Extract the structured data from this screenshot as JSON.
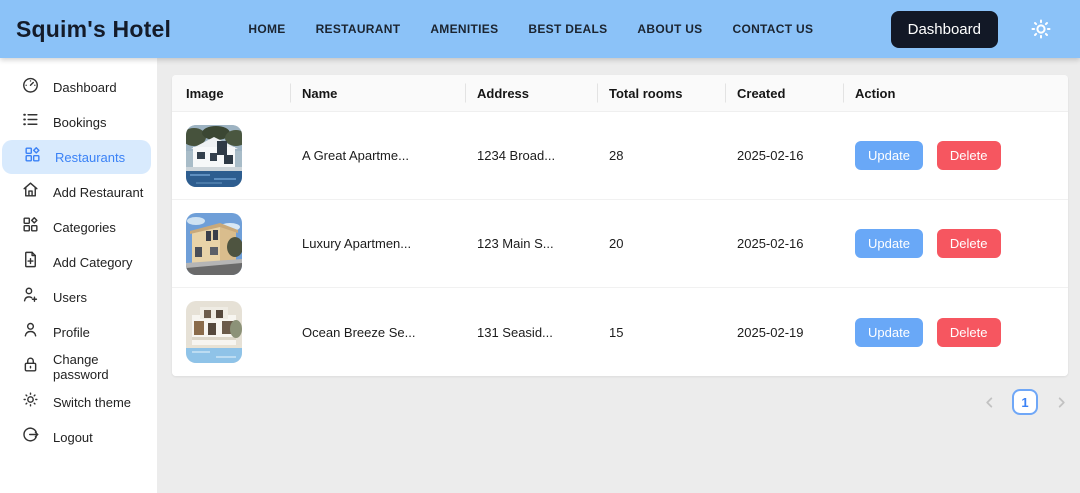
{
  "topbar": {
    "brand": "Squim's Hotel",
    "nav_items": [
      "HOME",
      "RESTAURANT",
      "AMENITIES",
      "BEST DEALS",
      "ABOUT US",
      "CONTACT US"
    ],
    "dashboard_button": "Dashboard",
    "theme_icon": "sun-icon",
    "colors": {
      "bg": "#8bc2f8",
      "button_bg": "#121826"
    }
  },
  "sidebar": {
    "active_item": "Restaurants",
    "colors": {
      "active_bg": "#d8eafd",
      "active_text": "#3b82f6"
    },
    "items": [
      {
        "label": "Dashboard",
        "icon": "gauge-icon"
      },
      {
        "label": "Bookings",
        "icon": "list-icon"
      },
      {
        "label": "Restaurants",
        "icon": "grid-icon"
      },
      {
        "label": "Add Restaurant",
        "icon": "home-icon"
      },
      {
        "label": "Categories",
        "icon": "grid-icon"
      },
      {
        "label": "Add Category",
        "icon": "file-plus-icon"
      },
      {
        "label": "Users",
        "icon": "users-icon"
      },
      {
        "label": "Profile",
        "icon": "user-icon"
      },
      {
        "label": "Change password",
        "icon": "lock-icon"
      },
      {
        "label": "Switch theme",
        "icon": "sun-icon"
      },
      {
        "label": "Logout",
        "icon": "logout-icon"
      }
    ]
  },
  "table": {
    "columns": [
      "Image",
      "Name",
      "Address",
      "Total rooms",
      "Created",
      "Action"
    ],
    "update_label": "Update",
    "delete_label": "Delete",
    "button_colors": {
      "update": "#69a8f7",
      "delete": "#f65660"
    },
    "rows": [
      {
        "image": "modern-white-house-photo",
        "name": "A Great Apartme...",
        "address": "1234 Broad...",
        "total_rooms": "28",
        "created": "2025-02-16"
      },
      {
        "image": "tan-apartment-building-photo",
        "name": "Luxury Apartmen...",
        "address": "123 Main S...",
        "total_rooms": "20",
        "created": "2025-02-16"
      },
      {
        "image": "white-seaside-house-photo",
        "name": "Ocean Breeze Se...",
        "address": "131 Seasid...",
        "total_rooms": "15",
        "created": "2025-02-19"
      }
    ]
  },
  "pagination": {
    "current_page": "1"
  }
}
